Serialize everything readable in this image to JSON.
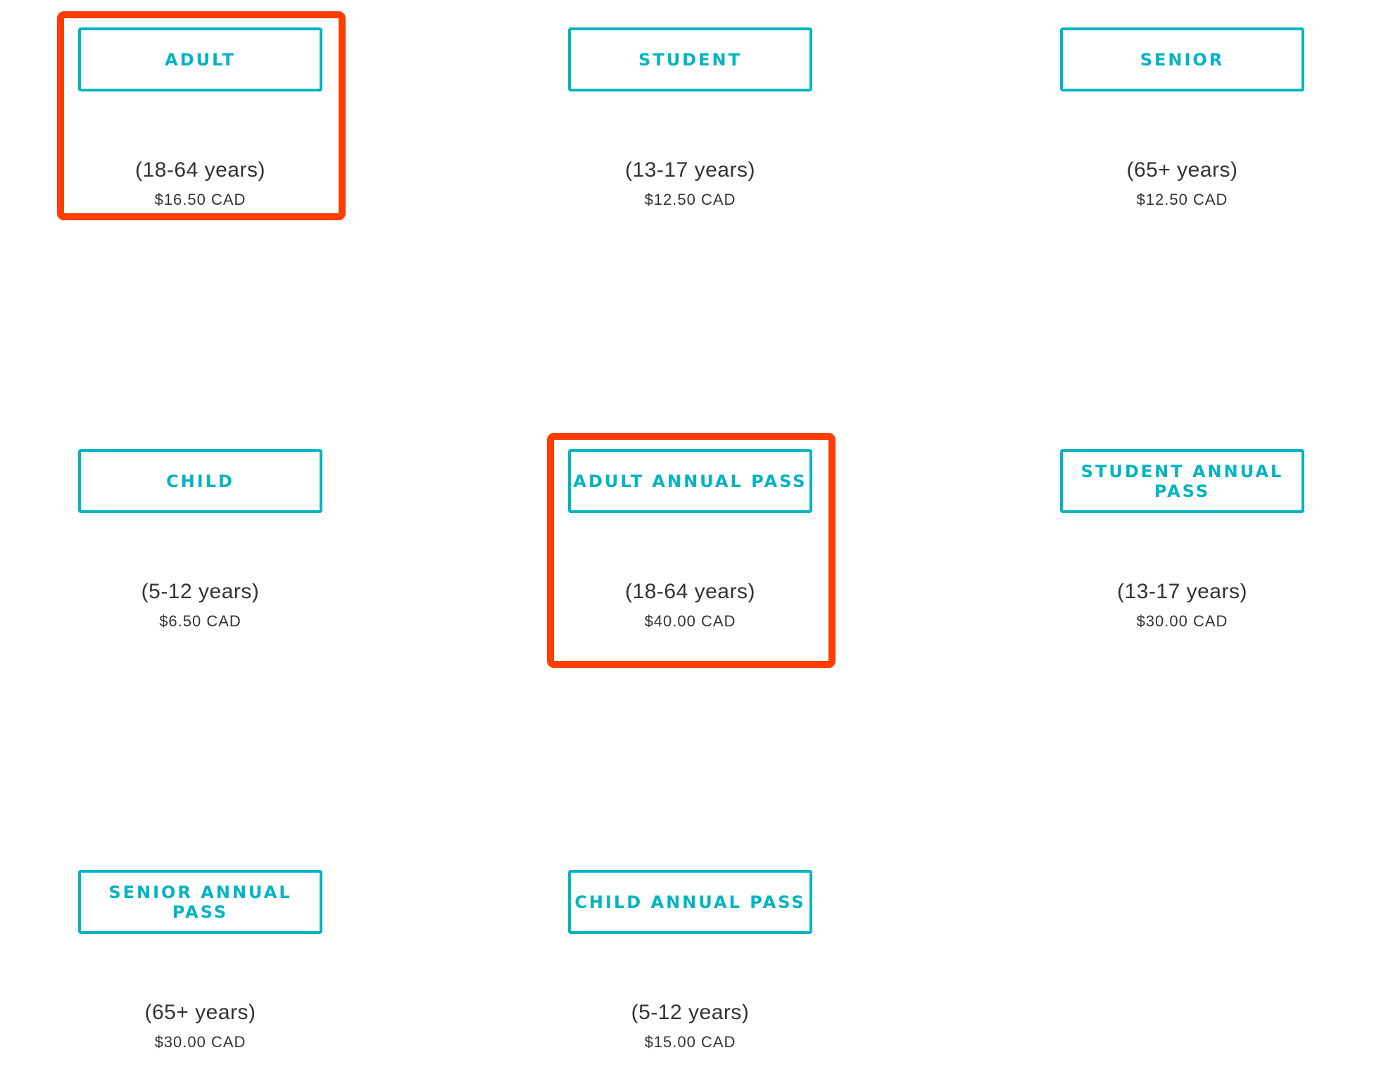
{
  "accent_color": "#00b4c1",
  "highlight_color": "#ff3d00",
  "tickets": [
    {
      "label": "ADULT",
      "age": "(18-64 years)",
      "price": "$16.50 CAD",
      "highlighted": true
    },
    {
      "label": "STUDENT",
      "age": "(13-17 years)",
      "price": "$12.50 CAD",
      "highlighted": false
    },
    {
      "label": "SENIOR",
      "age": "(65+ years)",
      "price": "$12.50 CAD",
      "highlighted": false
    },
    {
      "label": "CHILD",
      "age": "(5-12 years)",
      "price": "$6.50 CAD",
      "highlighted": false
    },
    {
      "label": "ADULT ANNUAL PASS",
      "age": "(18-64 years)",
      "price": "$40.00 CAD",
      "highlighted": true
    },
    {
      "label": "STUDENT ANNUAL PASS",
      "age": "(13-17 years)",
      "price": "$30.00 CAD",
      "highlighted": false
    },
    {
      "label": "SENIOR ANNUAL PASS",
      "age": "(65+ years)",
      "price": "$30.00 CAD",
      "highlighted": false
    },
    {
      "label": "CHILD ANNUAL PASS",
      "age": "(5-12 years)",
      "price": "$15.00 CAD",
      "highlighted": false
    }
  ]
}
